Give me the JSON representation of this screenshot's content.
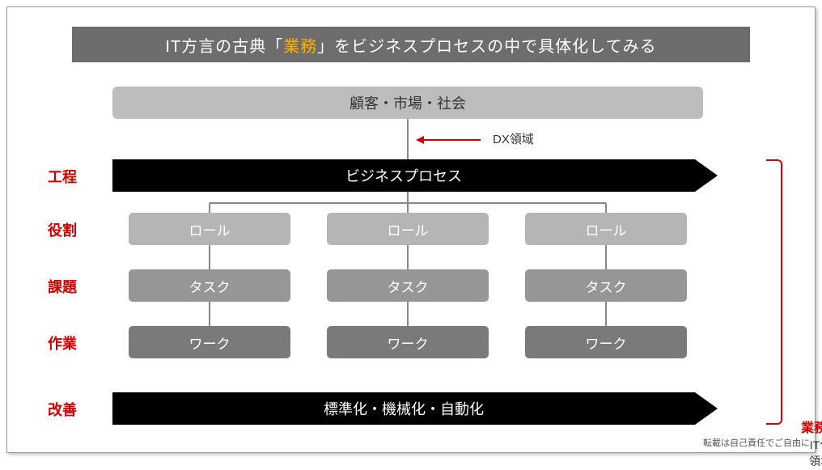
{
  "title": {
    "pre": "IT方言の古典「",
    "highlight": "業務",
    "post": "」をビジネスプロセスの中で具体化してみる"
  },
  "top_box": "顧客・市場・社会",
  "dx_label": "DX領域",
  "rows": {
    "process": {
      "label": "工程",
      "text": "ビジネスプロセス"
    },
    "role": {
      "label": "役割",
      "cells": [
        "ロール",
        "ロール",
        "ロール"
      ]
    },
    "task": {
      "label": "課題",
      "cells": [
        "タスク",
        "タスク",
        "タスク"
      ]
    },
    "work": {
      "label": "作業",
      "cells": [
        "ワーク",
        "ワーク",
        "ワーク"
      ]
    },
    "improve": {
      "label": "改善",
      "text": "標準化・機械化・自動化"
    }
  },
  "bracket": {
    "question": "業務？",
    "sub1": "IT化",
    "sub2": "領域"
  },
  "footnote": "転載は自己責任でご自由に"
}
